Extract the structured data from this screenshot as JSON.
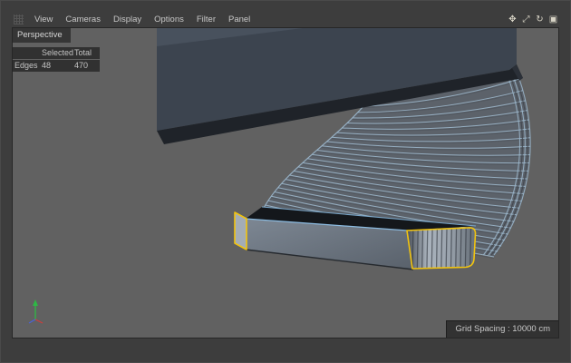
{
  "window": {
    "menu": {
      "items": [
        "View",
        "Cameras",
        "Display",
        "Options",
        "Filter",
        "Panel"
      ]
    },
    "toolbar": {
      "icons": [
        {
          "name": "pan-icon",
          "glyph": "✥"
        },
        {
          "name": "zoom-icon",
          "glyph": "⤢"
        },
        {
          "name": "rotate-icon",
          "glyph": "↻"
        },
        {
          "name": "maximize-icon",
          "glyph": "▣"
        }
      ]
    }
  },
  "viewport": {
    "camera_label": "Perspective",
    "stats": {
      "headers": {
        "selected": "Selected",
        "total": "Total"
      },
      "rows": [
        {
          "label": "Edges",
          "selected": "48",
          "total": "470"
        }
      ]
    },
    "status_bar": {
      "grid_spacing": "Grid Spacing : 10000 cm"
    }
  },
  "colors": {
    "selection_yellow": "#f2c40f",
    "edge_blue": "#8fc1e8",
    "viewport_bg": "#616161",
    "frame_bg": "#3d3d3d"
  }
}
